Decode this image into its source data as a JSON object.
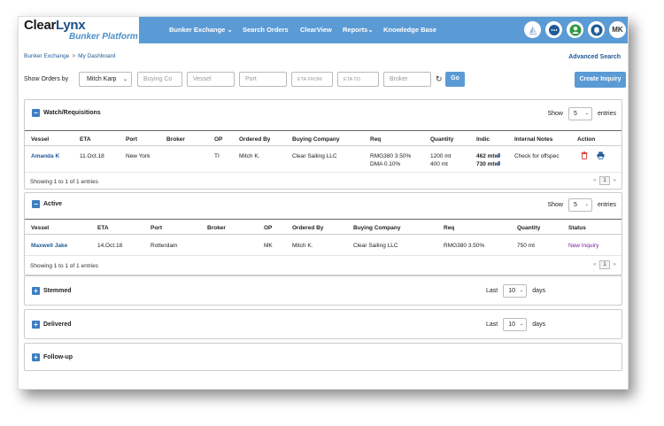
{
  "logo": {
    "main_clear": "Clear",
    "main_lynx": "Lynx",
    "subtitle": "Bunker Platform"
  },
  "nav": {
    "items": [
      {
        "label": "Bunker Exchange",
        "has_dropdown": true
      },
      {
        "label": "Search Orders",
        "has_dropdown": false
      },
      {
        "label": "ClearView",
        "has_dropdown": false
      },
      {
        "label": "Reports",
        "has_dropdown": true
      },
      {
        "label": "Knowledge Base",
        "has_dropdown": false
      }
    ],
    "user_initials": "MK"
  },
  "breadcrumb": {
    "root": "Bunker Exchange",
    "separator": ">",
    "current": "My Dashboard"
  },
  "advanced_search": "Advanced Search",
  "filters": {
    "label": "Show Orders by",
    "selected_user": "Mitch Karp",
    "buying_co_placeholder": "Buying Co",
    "vessel_placeholder": "Vessel",
    "port_placeholder": "Port",
    "eta_from_placeholder": "ETA FROM",
    "eta_to_placeholder": "ETA TO",
    "broker_placeholder": "Broker",
    "go_label": "Go",
    "create_inquiry_label": "Create Inquiry"
  },
  "watch": {
    "title": "Watch/Requisitions",
    "show_label": "Show",
    "entries_value": "5",
    "entries_label": "entries",
    "columns": [
      "Vessel",
      "ETA",
      "Port",
      "Broker",
      "OP",
      "Ordered By",
      "Buying Company",
      "Req",
      "Quantity",
      "Indic",
      "Internal Notes",
      "Action"
    ],
    "rows": [
      {
        "vessel": "Amanda K",
        "eta": "11.Oct.18",
        "port": "New York",
        "broker": "",
        "op": "TI",
        "ordered_by": "Mitch K.",
        "buying_company": "Clear Sailing LLC",
        "req1": "RMG380 3.50%",
        "req2": "DMA 0.10%",
        "qty1": "1200 mt",
        "qty2": "400 mt",
        "indic1": "462 mtw",
        "indic2": "730 mtw",
        "notes": "Check for offspec"
      }
    ],
    "showing": "Showing 1 to 1 of 1 entries",
    "page": "1"
  },
  "active": {
    "title": "Active",
    "show_label": "Show",
    "entries_value": "5",
    "entries_label": "entries",
    "columns": [
      "Vessel",
      "ETA",
      "Port",
      "Broker",
      "OP",
      "Ordered By",
      "Buying Company",
      "Req",
      "Quantity",
      "Status"
    ],
    "rows": [
      {
        "vessel": "Maxwell Jake",
        "eta": "14.Oct.18",
        "port": "Rotterdam",
        "broker": "",
        "op": "MK",
        "ordered_by": "Mitch K.",
        "buying_company": "Clear Sailing LLC",
        "req": "RMG380 3.50%",
        "quantity": "750 mt",
        "status": "New Inquiry"
      }
    ],
    "showing": "Showing 1 to 1 of 1 entries",
    "page": "1"
  },
  "stemmed": {
    "title": "Stemmed",
    "last_label": "Last",
    "days_value": "10",
    "days_label": "days"
  },
  "delivered": {
    "title": "Delivered",
    "last_label": "Last",
    "days_value": "10",
    "days_label": "days"
  },
  "followup": {
    "title": "Follow-up"
  },
  "colors": {
    "accent": "#5b9bd5",
    "link": "#1e5a96",
    "status_new": "#7a1fa2",
    "delete": "#d9342b"
  }
}
